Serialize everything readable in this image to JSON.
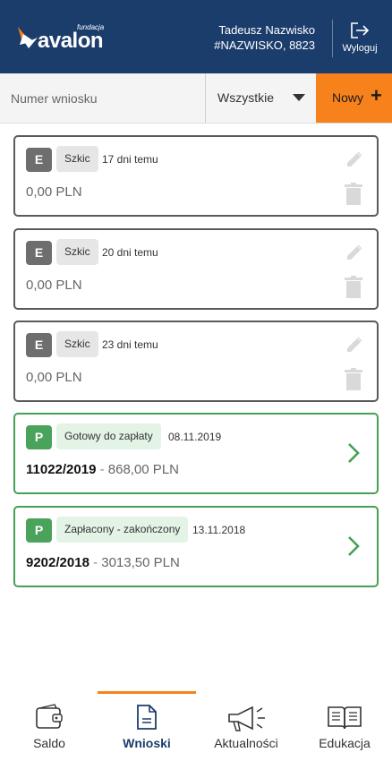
{
  "header": {
    "logo_small": "fundacja",
    "logo_name": "avalon",
    "user_name": "Tadeusz Nazwisko",
    "user_id": "#NAZWISKO, 8823",
    "logout_label": "Wyloguj",
    "logout_icon": "logout-icon"
  },
  "filter": {
    "search_placeholder": "Numer wniosku",
    "search_value": "",
    "select_value": "Wszystkie",
    "new_label": "Nowy",
    "new_plus": "+"
  },
  "cards": [
    {
      "type": "E",
      "status": "Szkic",
      "date": "17 dni temu",
      "amount": "0,00 PLN",
      "kind": "draft"
    },
    {
      "type": "E",
      "status": "Szkic",
      "date": "20 dni temu",
      "amount": "0,00 PLN",
      "kind": "draft"
    },
    {
      "type": "E",
      "status": "Szkic",
      "date": "23 dni temu",
      "amount": "0,00 PLN",
      "kind": "draft"
    },
    {
      "type": "P",
      "status": "Gotowy do zapłaty",
      "date": "08.11.2019",
      "number": "11022/2019",
      "separator": "-",
      "amount": "868,00 PLN",
      "kind": "payment"
    },
    {
      "type": "P",
      "status": "Zapłacony - zakończony",
      "date": "13.11.2018",
      "number": "9202/2018",
      "separator": "-",
      "amount": "3013,50 PLN",
      "kind": "payment"
    }
  ],
  "nav": [
    {
      "label": "Saldo",
      "icon": "wallet-icon",
      "active": false
    },
    {
      "label": "Wnioski",
      "icon": "document-icon",
      "active": true
    },
    {
      "label": "Aktualności",
      "icon": "megaphone-icon",
      "active": false
    },
    {
      "label": "Edukacja",
      "icon": "book-icon",
      "active": false
    }
  ],
  "colors": {
    "header_bg": "#1b3d6c",
    "accent": "#f7821b",
    "draft_border": "#5a5a5a",
    "payment_border": "#46a053",
    "payment_badge": "#4aa35a"
  }
}
